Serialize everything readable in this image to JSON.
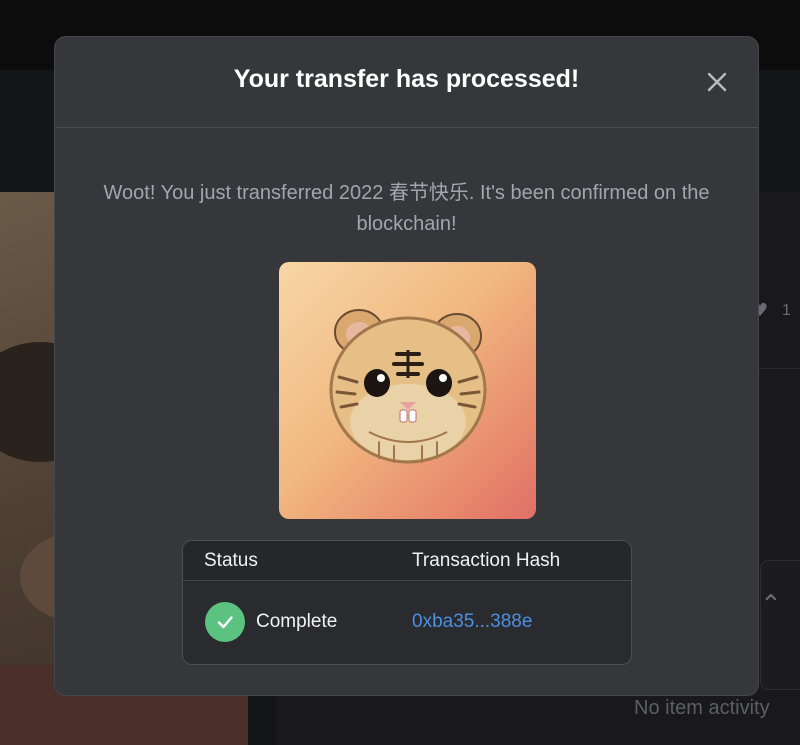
{
  "background": {
    "like_count": "1",
    "empty_activity_text": "No item activity"
  },
  "modal": {
    "title": "Your transfer has processed!",
    "close_icon": "close-icon",
    "message": "Woot! You just transferred 2022 春节快乐. It's been confirmed on the blockchain!",
    "nft_image_name": "tiger-cartoon-image",
    "table": {
      "columns": [
        "Status",
        "Transaction Hash"
      ],
      "row": {
        "status_icon": "check-circle-icon",
        "status": "Complete",
        "hash": "0xba35...388e"
      }
    }
  },
  "colors": {
    "modal_bg": "#35373b",
    "success": "#5cc27f",
    "link": "#4d8fe0"
  }
}
